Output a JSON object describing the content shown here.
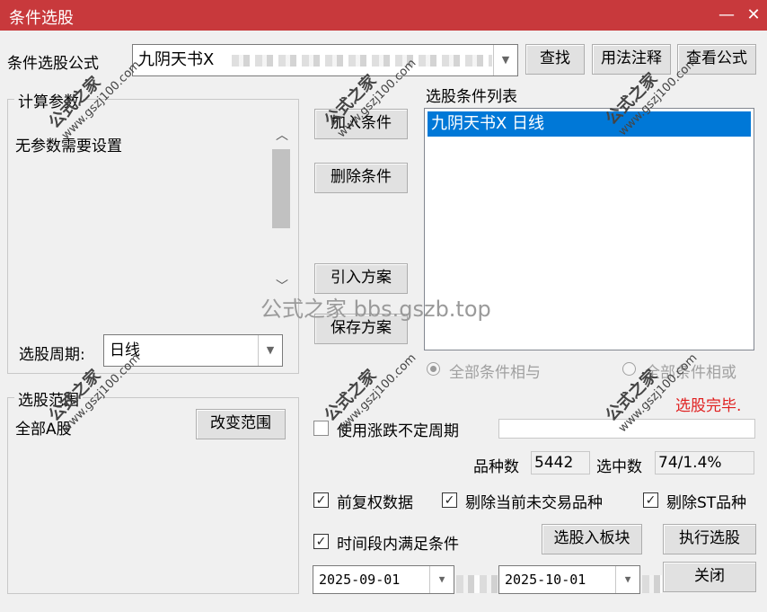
{
  "window": {
    "title": "条件选股",
    "minimize_glyph": "—",
    "close_glyph": "✕"
  },
  "formula": {
    "label": "条件选股公式",
    "value": "九阴天书X",
    "search_button": "查找",
    "usage_button": "用法注释",
    "view_button": "查看公式"
  },
  "params": {
    "group_title": "计算参数",
    "text": "无参数需要设置",
    "period_label": "选股周期:",
    "period_value": "日线"
  },
  "buttons": {
    "add_condition": "加入条件",
    "delete_condition": "删除条件",
    "import_plan": "引入方案",
    "save_plan": "保存方案",
    "change_range": "改变范围",
    "to_block": "选股入板块",
    "execute": "执行选股",
    "close": "关闭"
  },
  "condition_list": {
    "label": "选股条件列表",
    "items": [
      "九阴天书X  日线"
    ]
  },
  "logic": {
    "and_label": "全部条件相与",
    "or_label": "全部条件相或",
    "selected": "and"
  },
  "range": {
    "group_title": "选股范围",
    "value": "全部A股"
  },
  "status": {
    "text": "选股完毕.",
    "color": "#e02020"
  },
  "options": {
    "uncertain_period_label": "使用涨跌不定周期",
    "uncertain_period_checked": false,
    "uncertain_period_value": "",
    "count_label": "品种数",
    "count_value": "5442",
    "selected_label": "选中数",
    "selected_value": "74/1.4%",
    "forward_adjust_label": "前复权数据",
    "forward_adjust_checked": true,
    "exclude_untraded_label": "剔除当前未交易品种",
    "exclude_untraded_checked": true,
    "exclude_st_label": "剔除ST品种",
    "exclude_st_checked": true,
    "time_period_label": "时间段内满足条件",
    "time_period_checked": true,
    "start_date": "2025-09-01",
    "end_date": "2025-10-01"
  },
  "watermarks": {
    "brand": "公式之家",
    "url": "www.gszj100.com",
    "center_text": "公式之家 bbs.gszb.top"
  },
  "colors": {
    "titlebar": "#c8393c",
    "selection": "#0078d7"
  }
}
